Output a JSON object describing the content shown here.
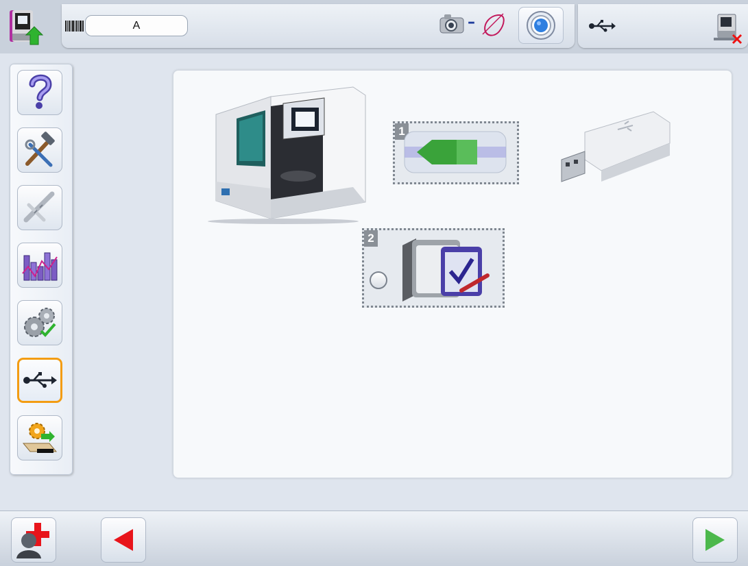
{
  "header": {
    "job_label": "A",
    "icons": {
      "machine_upload": "machine-upload-icon",
      "barcode": "barcode-icon",
      "camera": "camera-icon",
      "frame_shape": "frame-shape-icon",
      "target": "target-icon",
      "usb": "usb-icon",
      "disconnect": "machine-disconnect-icon"
    }
  },
  "sidebar": {
    "active_index": 5,
    "items": [
      {
        "icon": "help-icon"
      },
      {
        "icon": "tools-icon"
      },
      {
        "icon": "calibration-icon"
      },
      {
        "icon": "statistics-icon"
      },
      {
        "icon": "settings-icon"
      },
      {
        "icon": "usb-icon"
      },
      {
        "icon": "config-install-icon"
      }
    ]
  },
  "main": {
    "option1": {
      "number": "1",
      "icon": "export-arrow-icon"
    },
    "option2": {
      "number": "2",
      "icon": "folder-check-icon"
    }
  },
  "colors": {
    "active_border": "#f39c12",
    "back_arrow": "#e8141b",
    "next_arrow": "#4cb84c"
  },
  "footer": {
    "icons": {
      "help_user": "user-help-icon",
      "back": "back-arrow-icon",
      "next": "next-arrow-icon"
    }
  }
}
